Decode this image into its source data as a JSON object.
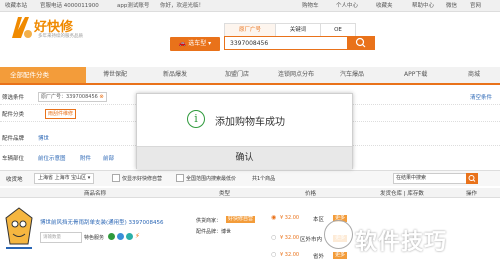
{
  "topbar": {
    "collect": "收藏本站",
    "phone": "官服电话 4000011900",
    "app": "app测试账号",
    "welcome": "你好，欢迎光临！",
    "cart": "购物车",
    "member": "个人中心",
    "favorite": "收藏夹",
    "help": "帮助中心",
    "wechat": "微信",
    "more": "官网"
  },
  "logo": {
    "name": "好快修",
    "tagline": "多年来持续的服务品质"
  },
  "search": {
    "tabs": [
      "原厂广号",
      "关键词",
      "OE"
    ],
    "select_label": "选车型",
    "value": "3397008456"
  },
  "nav": {
    "all": "全部配件分类",
    "items": [
      "博世保配",
      "新品爆发",
      "加盟门店",
      "连锁网点分布",
      "汽车爆品",
      "APP下载",
      "商城"
    ]
  },
  "filters": {
    "selected_label": "筛选条件",
    "selected_chip": "原厂广号：3397008456",
    "clear": "清空条件",
    "category_label": "配件分类",
    "category_chip": "雨刮件维修",
    "brand_label": "配件品牌",
    "brand_value": "博世",
    "position_label": "车辆部位",
    "positions": [
      "前位示意图",
      "附件",
      "前部"
    ]
  },
  "location": {
    "label": "收货地",
    "value": "上海省 上海市 宝山区",
    "only_stock": "仅显示好快修自营",
    "nationwide": "全国范围内搜索最低价",
    "count": "共1个商品",
    "search_placeholder": "在结果中搜索"
  },
  "table_header": [
    "商品名称",
    "类型",
    "价格",
    "发货仓库 | 库存数",
    "操作"
  ],
  "product": {
    "name": "博世前风挡无骨雨刮单支装(通用型) 3397008456",
    "service_label": "特色服务",
    "supplier_label": "供货商家：",
    "supplier_chip": "好快修自营",
    "brand_line": "配件品牌：博世",
    "prices": [
      {
        "value": "¥ 32.00",
        "warehouse": "本区",
        "action": "更多"
      },
      {
        "value": "¥ 32.00",
        "warehouse": "区外市内",
        "action": "更多"
      },
      {
        "value": "¥ 32.00",
        "warehouse": "省外",
        "action": "更多"
      }
    ],
    "qty_placeholder": "请输数量"
  },
  "dialog": {
    "message": "添加购物车成功",
    "confirm": "确认"
  },
  "watermark": "软件技巧",
  "colors": {
    "accent": "#e9721a",
    "success": "#2f9a3c",
    "link": "#2a66b5"
  }
}
